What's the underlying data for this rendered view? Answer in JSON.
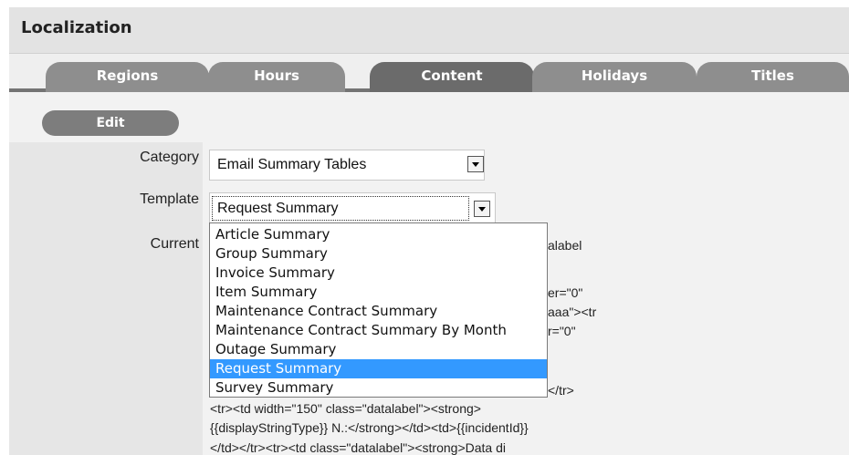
{
  "header": {
    "title": "Localization"
  },
  "tabs": [
    {
      "label": "Regions",
      "active": false
    },
    {
      "label": "Hours",
      "active": false
    },
    {
      "label": "Content",
      "active": true
    },
    {
      "label": "Holidays",
      "active": false
    },
    {
      "label": "Titles",
      "active": false
    }
  ],
  "toolbar": {
    "edit_label": "Edit"
  },
  "form": {
    "category_label": "Category",
    "category_value": "Email Summary Tables",
    "template_label": "Template",
    "template_value": "Request Summary",
    "current_label": "Current"
  },
  "template_options": [
    "Article Summary",
    "Group Summary",
    "Invoice Summary",
    "Item Summary",
    "Maintenance Contract Summary",
    "Maintenance Contract Summary By Month",
    "Outage Summary",
    "Request Summary",
    "Survey Summary"
  ],
  "selected_option_index": 7,
  "current_code": {
    "peek": [
      "alabel",
      "er=\"0\"",
      "aaa\"><tr",
      "r=\"0\"",
      "</tr>"
    ],
    "lines": [
      "<tr><td width=\"150\" class=\"datalabel\"><strong>",
      "{{displayStringType}} N.:</strong></td><td>{{incidentId}}",
      "</td></tr><tr><td class=\"datalabel\"><strong>Data di"
    ]
  }
}
